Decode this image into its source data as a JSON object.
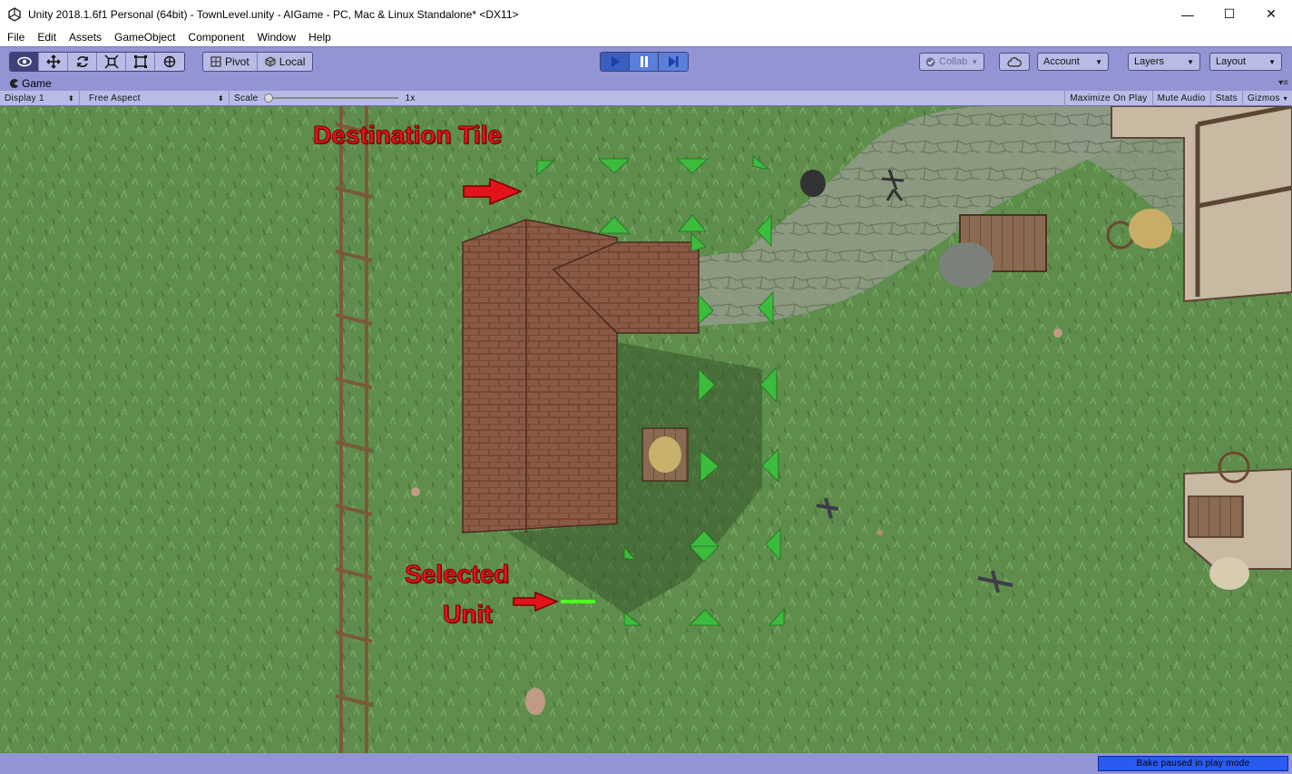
{
  "window": {
    "title": "Unity 2018.1.6f1 Personal (64bit) - TownLevel.unity - AIGame - PC, Mac & Linux Standalone* <DX11>",
    "minimize": "—",
    "maximize": "☐",
    "close": "✕"
  },
  "menu": [
    "File",
    "Edit",
    "Assets",
    "GameObject",
    "Component",
    "Window",
    "Help"
  ],
  "toolbar": {
    "tools": [
      "view-tool-icon",
      "move-tool-icon",
      "rotate-tool-icon",
      "scale-tool-icon",
      "rect-tool-icon",
      "transform-tool-icon"
    ],
    "pivot_label": "Pivot",
    "local_label": "Local",
    "play_controls": [
      "play-icon",
      "pause-icon",
      "step-icon"
    ],
    "collab_label": "Collab",
    "account_label": "Account",
    "layers_label": "Layers",
    "layout_label": "Layout"
  },
  "game_tab": {
    "label": "Game"
  },
  "game_bar": {
    "display": "Display 1",
    "aspect": "Free Aspect",
    "scale_label": "Scale",
    "scale_value": "1x",
    "maximize_on_play": "Maximize On Play",
    "mute_audio": "Mute Audio",
    "stats": "Stats",
    "gizmos": "Gizmos"
  },
  "annotations": {
    "destination": "Destination Tile",
    "selected_line1": "Selected",
    "selected_line2": "Unit"
  },
  "status": {
    "bake": "Bake paused in play mode"
  },
  "colors": {
    "toolbar": "#9294d3",
    "accent_play": "#3a5fc0",
    "grass": "#5b8a4a",
    "annotation": "#e2141a",
    "tile_marker": "#3dbb3d"
  }
}
